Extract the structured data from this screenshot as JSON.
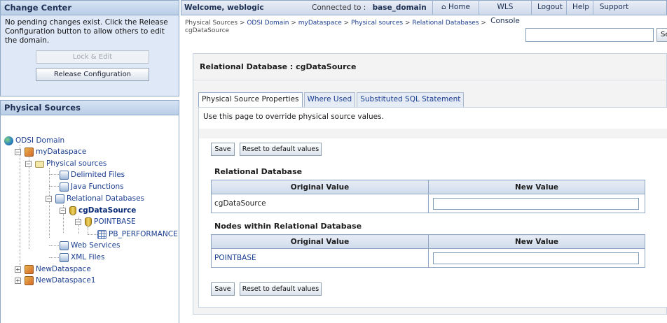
{
  "change_center": {
    "title": "Change Center",
    "message": "No pending changes exist. Click the Release Configuration button to allow others to edit the domain.",
    "lock_label": "Lock & Edit",
    "release_label": "Release Configuration"
  },
  "physical_sources": {
    "title": "Physical Sources",
    "tree": [
      {
        "label": "ODSI Domain",
        "icon": "globe-icon"
      },
      {
        "label": "myDataspace",
        "icon": "dataspace-icon"
      },
      {
        "label": "Physical sources",
        "icon": "folder-icon"
      },
      {
        "label": "Delimited Files",
        "icon": "source-icon"
      },
      {
        "label": "Java Functions",
        "icon": "source-icon"
      },
      {
        "label": "Relational Databases",
        "icon": "source-icon"
      },
      {
        "label": "cgDataSource",
        "icon": "database-icon"
      },
      {
        "label": "POINTBASE",
        "icon": "database-icon"
      },
      {
        "label": "PB_PERFORMANCE",
        "icon": "table-icon"
      },
      {
        "label": "Web Services",
        "icon": "source-icon"
      },
      {
        "label": "XML Files",
        "icon": "source-icon"
      },
      {
        "label": "NewDataspace",
        "icon": "dataspace-icon"
      },
      {
        "label": "NewDataspace1",
        "icon": "dataspace-icon"
      }
    ]
  },
  "topbar": {
    "welcome": "Welcome, weblogic",
    "connected_label": "Connected to :",
    "domain": "base_domain",
    "home": "Home",
    "console": "WLS Console",
    "logout": "Logout",
    "help": "Help",
    "support": "Support"
  },
  "breadcrumb": {
    "items": [
      "Physical Sources",
      "ODSI Domain",
      "myDataspace",
      "Physical sources",
      "Relational Databases"
    ],
    "current": "cgDataSource",
    "sep": " > "
  },
  "search": {
    "button": "Search",
    "placeholder": ""
  },
  "main": {
    "title": "Relational Database : cgDataSource",
    "tabs": [
      "Physical Source Properties",
      "Where Used",
      "Substituted SQL Statement"
    ],
    "hint": "Use this page to override physical source values.",
    "save_label": "Save",
    "reset_label": "Reset to default values",
    "section1": {
      "title": "Relational Database",
      "col_original": "Original Value",
      "col_new": "New Value",
      "rows": [
        {
          "original": "cgDataSource",
          "new": ""
        }
      ]
    },
    "section2": {
      "title": "Nodes within Relational Database",
      "col_original": "Original Value",
      "col_new": "New Value",
      "rows": [
        {
          "original": "POINTBASE",
          "new": ""
        }
      ]
    }
  }
}
